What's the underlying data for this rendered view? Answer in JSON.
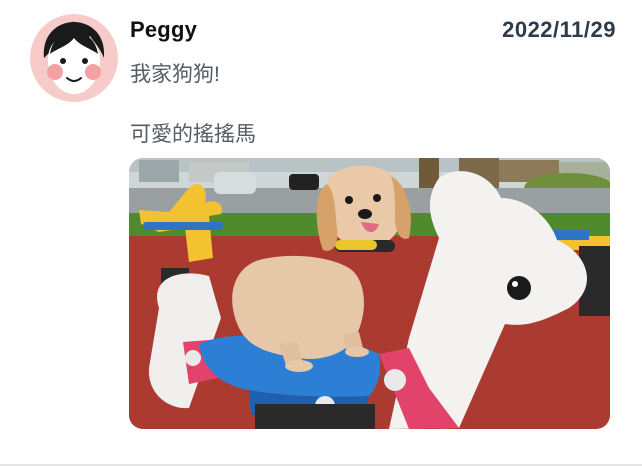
{
  "post": {
    "author": "Peggy",
    "date": "2022/11/29",
    "text_lines": [
      "我家狗狗!",
      "可愛的搖搖馬"
    ]
  },
  "avatar": {
    "icon": "cartoon-face-icon",
    "bg_color": "#f6cbc9"
  },
  "photo": {
    "icon": "dog-on-rocking-horse-photo"
  }
}
